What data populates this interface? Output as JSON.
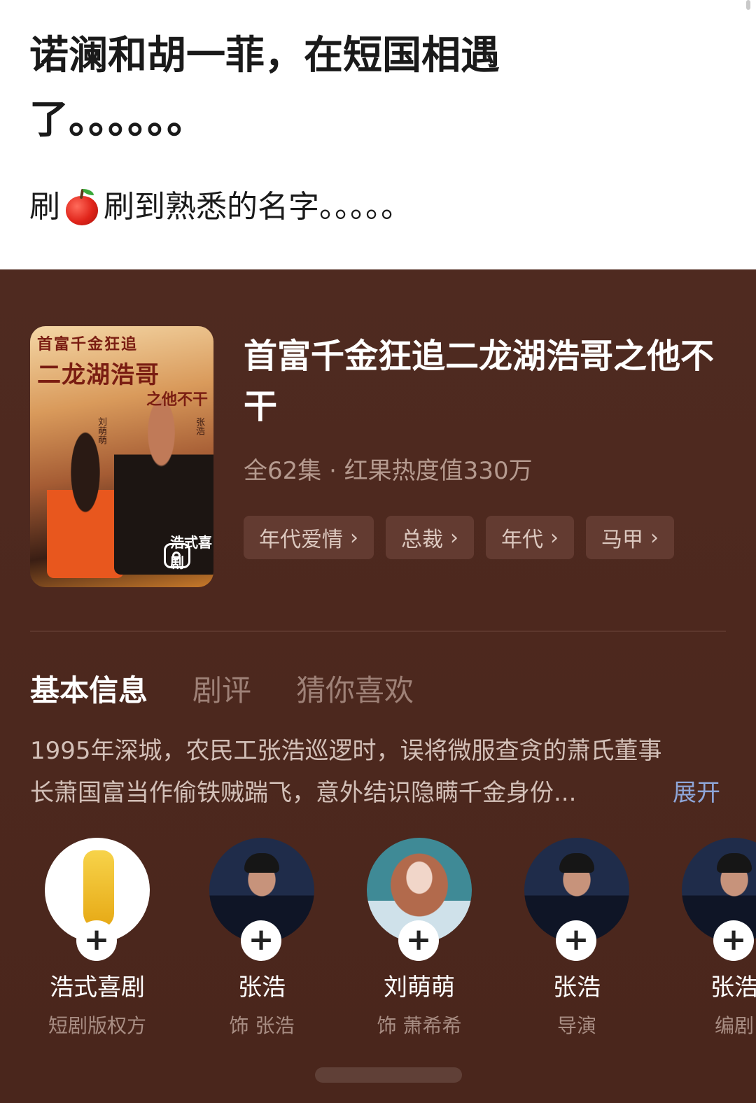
{
  "post": {
    "line1": "诺澜和胡一菲，在短国相遇",
    "line2": "了。。。。。。",
    "line3_prefix": "刷",
    "line3_icon": "apple-emoji",
    "line3_suffix": "刷到熟悉的名字。。。。。"
  },
  "drama": {
    "poster": {
      "title_line1": "首富千金狂追",
      "title_line2": "二龙湖浩哥",
      "title_line3": "之他不干",
      "cast_left": "刘萌萌",
      "cast_right": "张浩",
      "studio": "浩式喜剧"
    },
    "title": "首富千金狂追二龙湖浩哥之他不干",
    "meta": "全62集 · 红果热度值330万",
    "tags": [
      "年代爱情",
      "总裁",
      "年代",
      "马甲"
    ]
  },
  "tabs": [
    "基本信息",
    "剧评",
    "猜你喜欢"
  ],
  "synopsis": {
    "line1": "1995年深城，农民工张浩巡逻时，误将微服查贪的萧氏董事",
    "line2": "长萧国富当作偷铁贼踹飞，意外结识隐瞒千金身份...",
    "expand": "展开"
  },
  "cast": [
    {
      "name": "浩式喜剧",
      "role": "短剧版权方",
      "avatar": "logo"
    },
    {
      "name": "张浩",
      "role": "饰 张浩",
      "avatar": "man"
    },
    {
      "name": "刘萌萌",
      "role": "饰 萧希希",
      "avatar": "woman"
    },
    {
      "name": "张浩",
      "role": "导演",
      "avatar": "man"
    },
    {
      "name": "张浩",
      "role": "编剧",
      "avatar": "man"
    }
  ],
  "colors": {
    "card_bg": "#4f2a20",
    "tag_bg": "#633b31",
    "expand_link": "#8ea6d8"
  }
}
